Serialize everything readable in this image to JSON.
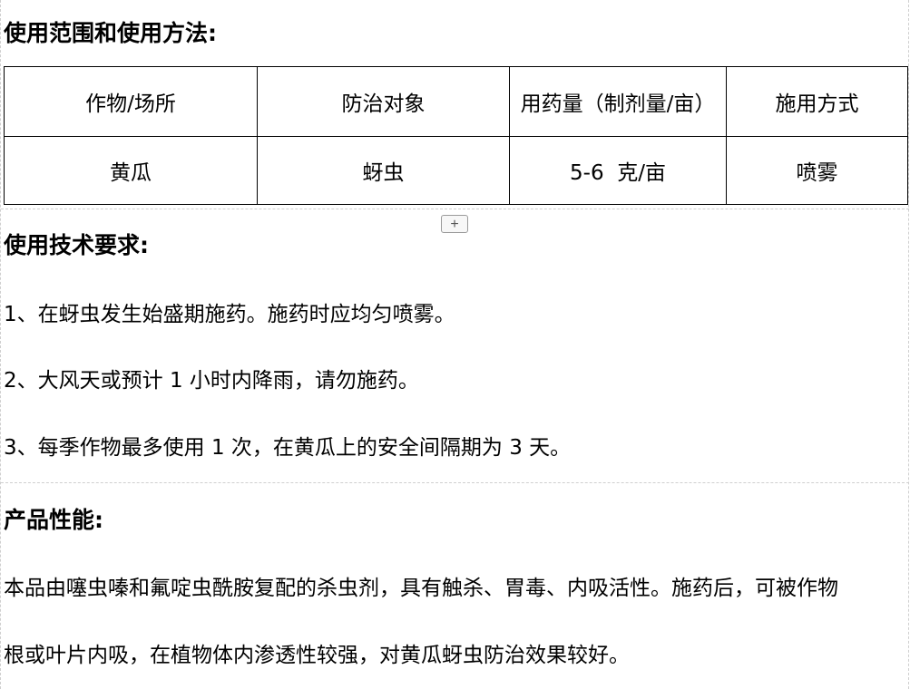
{
  "usage_section": {
    "heading": "使用范围和使用方法:",
    "table": {
      "headers": [
        "作物/场所",
        "防治对象",
        "用药量（制剂量/亩）",
        "施用方式"
      ],
      "rows": [
        [
          "黄瓜",
          "蚜虫",
          "5-6  克/亩",
          "喷雾"
        ]
      ]
    },
    "add_button_label": "+"
  },
  "technical_section": {
    "heading": "使用技术要求:",
    "items": [
      "1、在蚜虫发生始盛期施药。施药时应均匀喷雾。",
      "2、大风天或预计 1 小时内降雨，请勿施药。",
      "3、每季作物最多使用 1 次，在黄瓜上的安全间隔期为 3 天。"
    ]
  },
  "performance_section": {
    "heading": "产品性能:",
    "lines": [
      "本品由噻虫嗪和氟啶虫酰胺复配的杀虫剂，具有触杀、胃毒、内吸活性。施药后，可被作物",
      "根或叶片内吸，在植物体内渗透性较强，对黄瓜蚜虫防治效果较好。"
    ]
  }
}
